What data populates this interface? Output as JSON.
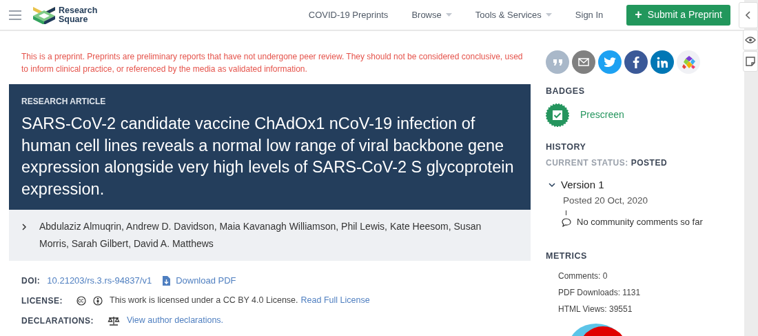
{
  "header": {
    "logo_lines": [
      "Research",
      "Square"
    ],
    "nav": [
      {
        "label": "COVID-19 Preprints",
        "dropdown": false
      },
      {
        "label": "Browse",
        "dropdown": true
      },
      {
        "label": "Tools & Services",
        "dropdown": true
      },
      {
        "label": "Sign In",
        "dropdown": false
      }
    ],
    "submit_button": {
      "icon_text": "+",
      "label": "Submit a Preprint"
    }
  },
  "notice": "This is a preprint. Preprints are preliminary reports that have not undergone peer review. They should not be considered conclusive, used to inform clinical practice, or referenced by the media as validated information.",
  "article": {
    "type_label": "RESEARCH ARTICLE",
    "title": "SARS-CoV-2 candidate vaccine ChAdOx1 nCoV-19 infection of human cell lines reveals a normal low range of viral backbone gene expression alongside very high levels of SARS-CoV-2 S glycoprotein expression.",
    "authors": "Abdulaziz Almuqrin, Andrew D. Davidson, Maia Kavanagh Williamson, Phil Lewis, Kate Heesom, Susan Morris, Sarah Gilbert, David A. Matthews",
    "authors_expanded": false
  },
  "meta": {
    "doi_label": "DOI:",
    "doi": "10.21203/rs.3.rs-94837/v1",
    "download": "Download PDF",
    "license_label": "LICENSE:",
    "license_text": "This work is licensed under a CC BY 4.0 License.",
    "license_link": "Read Full License",
    "declarations_label": "DECLARATIONS:",
    "declarations_link": "View author declarations."
  },
  "sidebar": {
    "share": [
      {
        "kind": "cite",
        "color": "#a9b8c9"
      },
      {
        "kind": "email",
        "color": "#808080"
      },
      {
        "kind": "twitter",
        "color": "#1da1f2"
      },
      {
        "kind": "facebook",
        "color": "#3b5998"
      },
      {
        "kind": "linkedin",
        "color": "#0077b5"
      },
      {
        "kind": "mendeley",
        "color": "#f0f1f5"
      }
    ],
    "badges_heading": "BADGES",
    "badge": "Prescreen",
    "history_heading": "HISTORY",
    "status_label": "CURRENT STATUS:",
    "status_value": "POSTED",
    "versions": [
      {
        "label": "Version 1",
        "expanded": true,
        "posted": "Posted 20 Oct, 2020",
        "comments": "No community comments so far"
      }
    ],
    "metrics_heading": "METRICS",
    "metrics": [
      "Comments: 0",
      "PDF Downloads: 1131",
      "HTML Views: 39551"
    ]
  }
}
